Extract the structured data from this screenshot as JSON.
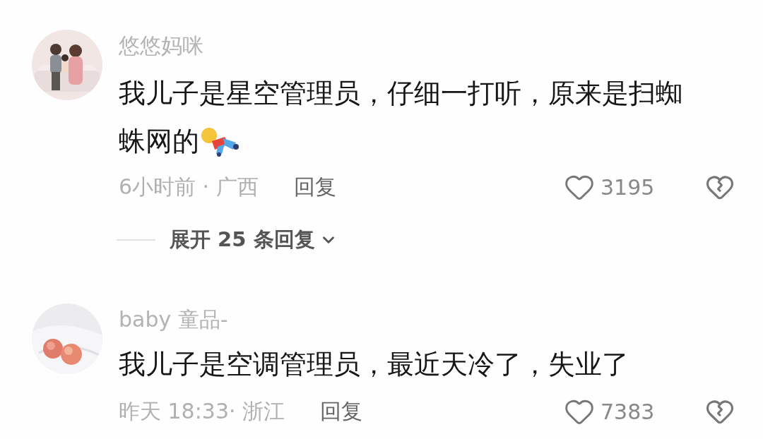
{
  "comments": [
    {
      "username": "悠悠妈咪",
      "avatar": {
        "kind": "picture"
      },
      "lines": [
        "我儿子是星空管理员，仔细一打听，原来是扫蜘",
        "蛛网的"
      ],
      "sticker": true,
      "meta": "6小时前 · 广西",
      "reply": "回复",
      "likes": "3195",
      "expand_replies": "展开 25 条回复"
    },
    {
      "username": "baby 童品-",
      "avatar": {
        "kind": "picture"
      },
      "lines": [
        "我儿子是空调管理员，最近天冷了，失业了"
      ],
      "sticker": false,
      "meta": "昨天 18:33· 浙江",
      "reply": "回复",
      "likes": "7383"
    }
  ]
}
